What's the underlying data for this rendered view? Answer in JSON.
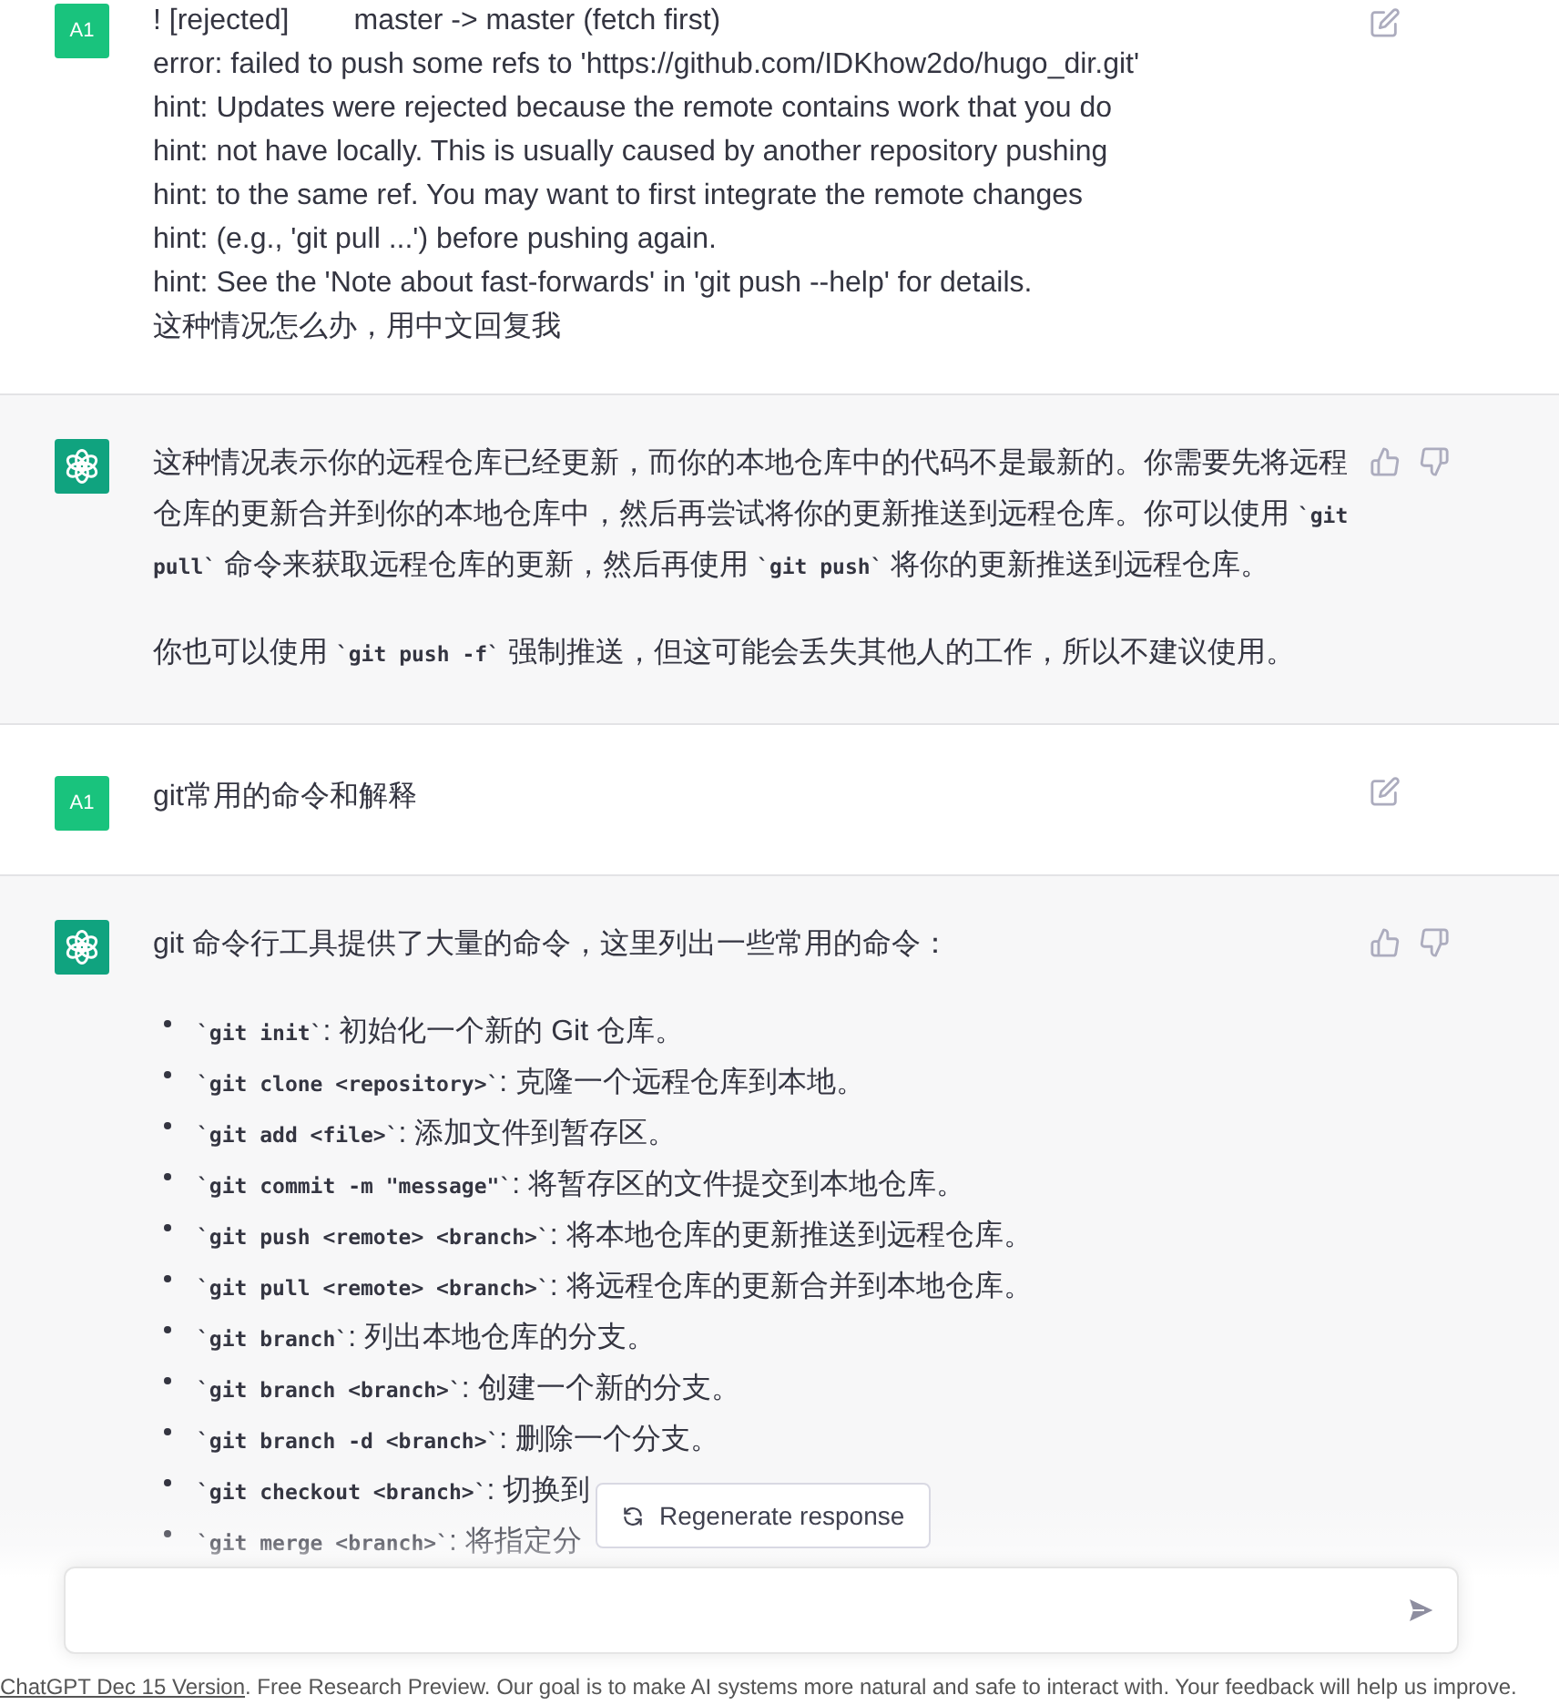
{
  "messages": [
    {
      "kind": "user",
      "avatar": "A1",
      "lines": [
        "! [rejected]        master -> master (fetch first)",
        "error: failed to push some refs to 'https://github.com/IDKhow2do/hugo_dir.git'",
        "hint: Updates were rejected because the remote contains work that you do",
        "hint: not have locally. This is usually caused by another repository pushing",
        "hint: to the same ref. You may want to first integrate the remote changes",
        "hint: (e.g., 'git pull ...') before pushing again.",
        "hint: See the 'Note about fast-forwards' in 'git push --help' for details.",
        "这种情况怎么办，用中文回复我"
      ]
    },
    {
      "kind": "assistant",
      "blocks": [
        {
          "kind": "paragraph",
          "segments": [
            {
              "kind": "text",
              "text": "这种情况表示你的远程仓库已经更新，而你的本地仓库中的代码不是最新的。你需要先将远程仓库的更新合并到你的本地仓库中，然后再尝试将你的更新推送到远程仓库。你可以使用 "
            },
            {
              "kind": "code",
              "text": "`git pull`"
            },
            {
              "kind": "text",
              "text": " 命令来获取远程仓库的更新，然后再使用 "
            },
            {
              "kind": "code",
              "text": "`git push`"
            },
            {
              "kind": "text",
              "text": " 将你的更新推送到远程仓库。"
            }
          ]
        },
        {
          "kind": "paragraph",
          "segments": [
            {
              "kind": "text",
              "text": "你也可以使用 "
            },
            {
              "kind": "code",
              "text": "`git push -f`"
            },
            {
              "kind": "text",
              "text": " 强制推送，但这可能会丢失其他人的工作，所以不建议使用。"
            }
          ]
        }
      ]
    },
    {
      "kind": "user",
      "avatar": "A1",
      "lines": [
        "git常用的命令和解释"
      ]
    },
    {
      "kind": "assistant",
      "blocks": [
        {
          "kind": "paragraph",
          "segments": [
            {
              "kind": "text",
              "text": "git 命令行工具提供了大量的命令，这里列出一些常用的命令："
            }
          ]
        },
        {
          "kind": "list",
          "items": [
            {
              "code": "`git init`",
              "text": ": 初始化一个新的 Git 仓库。"
            },
            {
              "code": "`git clone <repository>`",
              "text": ": 克隆一个远程仓库到本地。"
            },
            {
              "code": "`git add <file>`",
              "text": ": 添加文件到暂存区。"
            },
            {
              "code": "`git commit -m \"message\"`",
              "text": ": 将暂存区的文件提交到本地仓库。"
            },
            {
              "code": "`git push <remote> <branch>`",
              "text": ": 将本地仓库的更新推送到远程仓库。"
            },
            {
              "code": "`git pull <remote> <branch>`",
              "text": ": 将远程仓库的更新合并到本地仓库。"
            },
            {
              "code": "`git branch`",
              "text": ": 列出本地仓库的分支。"
            },
            {
              "code": "`git branch <branch>`",
              "text": ": 创建一个新的分支。"
            },
            {
              "code": "`git branch -d <branch>`",
              "text": ": 删除一个分支。"
            },
            {
              "code": "`git checkout <branch>`",
              "text": ": 切换到"
            },
            {
              "code": "`git merge <branch>`",
              "text": ": 将指定分"
            }
          ]
        }
      ]
    }
  ],
  "regenerate_button": "Regenerate response",
  "footer": {
    "link": "ChatGPT Dec 15 Version",
    "text": ". Free Research Preview. Our goal is to make AI systems more natural and safe to interact with. Your feedback will help us improve."
  }
}
